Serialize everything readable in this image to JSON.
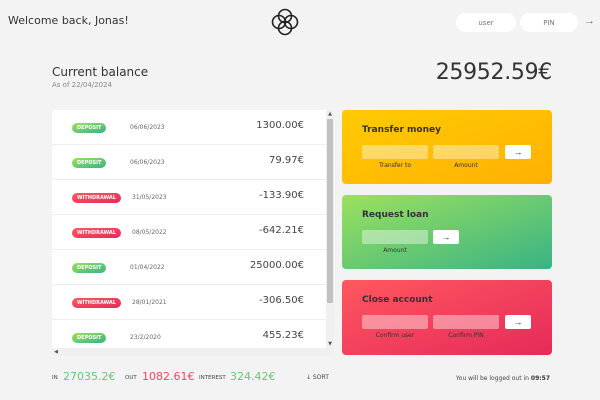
{
  "nav": {
    "welcome": "Welcome back, Jonas!",
    "user_placeholder": "user",
    "pin_placeholder": "PIN",
    "login_icon": "arrow-right-icon"
  },
  "balance": {
    "label": "Current balance",
    "date": "As of 22/04/2024",
    "value": "25952.59€"
  },
  "movements": [
    {
      "type": "DEPOSIT",
      "date": "06/06/2023",
      "value": "1300.00€"
    },
    {
      "type": "DEPOSIT",
      "date": "06/06/2023",
      "value": "79.97€"
    },
    {
      "type": "WITHDRAWAL",
      "date": "31/05/2023",
      "value": "-133.90€"
    },
    {
      "type": "WITHDRAWAL",
      "date": "08/05/2022",
      "value": "-642.21€"
    },
    {
      "type": "DEPOSIT",
      "date": "01/04/2022",
      "value": "25000.00€"
    },
    {
      "type": "WITHDRAWAL",
      "date": "28/01/2021",
      "value": "-306.50€"
    },
    {
      "type": "DEPOSIT",
      "date": "23/2/2020",
      "value": "455.23€"
    }
  ],
  "operations": {
    "transfer": {
      "title": "Transfer money",
      "label_to": "Transfer to",
      "label_amount": "Amount",
      "btn": "→"
    },
    "loan": {
      "title": "Request loan",
      "label_amount": "Amount",
      "btn": "→"
    },
    "close": {
      "title": "Close account",
      "label_user": "Confirm user",
      "label_pin": "Confirm PIN",
      "btn": "→"
    }
  },
  "summary": {
    "in_label": "IN",
    "in_value": "27035.2€",
    "out_label": "OUT",
    "out_value": "1082.61€",
    "interest_label": "INTEREST",
    "interest_value": "324.42€",
    "sort_label": "↓ SORT"
  },
  "logout": {
    "text": "You will be logged out in",
    "time": "09:57"
  },
  "colors": {
    "deposit": "#39b385",
    "withdrawal": "#e52a5a",
    "transfer": "#ffb003",
    "loan": "#39b385",
    "close": "#e52a5a"
  }
}
